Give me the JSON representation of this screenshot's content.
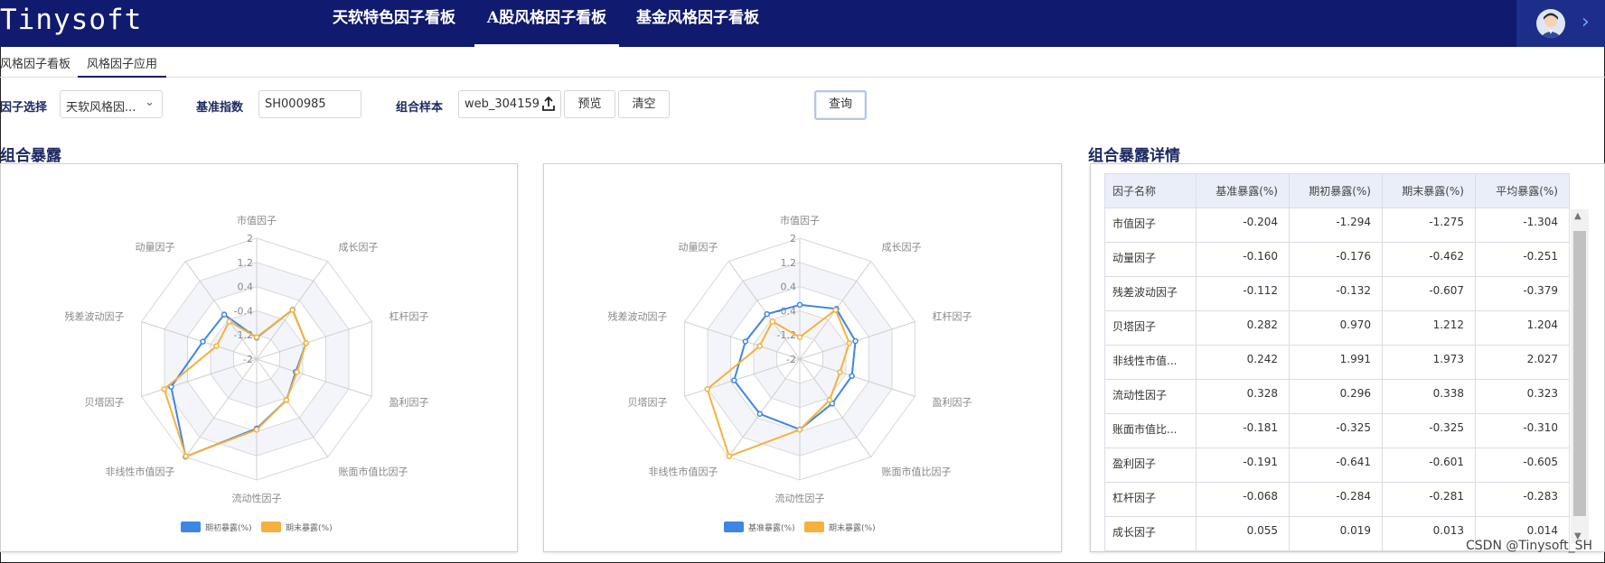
{
  "app": {
    "logo": "Tinysoft",
    "nav": [
      "天软特色因子看板",
      "A股风格因子看板",
      "基金风格因子看板"
    ],
    "nav_active_index": 1,
    "avatar_icon": "user-avatar-icon",
    "expand_icon": "chevron-right-icon"
  },
  "subtabs": [
    "风格因子看板",
    "风格因子应用"
  ],
  "subtab_active_index": 1,
  "filters": {
    "factor_label": "因子选择",
    "factor_value": "天软风格因...",
    "benchmark_label": "基准指数",
    "benchmark_value": "SH000985",
    "portfolio_label": "组合样本",
    "portfolio_value": "web_304159",
    "upload_icon": "upload-icon",
    "preview_button": "预览",
    "clear_button": "清空",
    "query_button": "查询"
  },
  "sections": {
    "exposure_title": "组合暴露",
    "detail_title": "组合暴露详情"
  },
  "colors": {
    "header_bg": "#101a6e",
    "blue_series": "#3e86e6",
    "orange_series": "#f5b13d"
  },
  "chart_data": [
    {
      "type": "radar",
      "indicators": [
        "市值因子",
        "成长因子",
        "杠杆因子",
        "盈利因子",
        "账面市值比因子",
        "流动性因子",
        "非线性市值因子",
        "贝塔因子",
        "残差波动因子",
        "动量因子"
      ],
      "ticks": [
        "2",
        "1.2",
        "0.4",
        "-0.4",
        "-1.2",
        "-2"
      ],
      "range": [
        -2,
        2
      ],
      "legend_position": "bottom",
      "series": [
        {
          "name": "期初暴露(%)",
          "color": "#3e86e6",
          "values": [
            -1.294,
            0.019,
            -0.284,
            -0.641,
            -0.325,
            0.296,
            1.991,
            0.97,
            -0.132,
            -0.176
          ]
        },
        {
          "name": "期末暴露(%)",
          "color": "#f5b13d",
          "values": [
            -1.275,
            0.013,
            -0.281,
            -0.601,
            -0.325,
            0.338,
            1.973,
            1.212,
            -0.607,
            -0.462
          ]
        }
      ]
    },
    {
      "type": "radar",
      "indicators": [
        "市值因子",
        "成长因子",
        "杠杆因子",
        "盈利因子",
        "账面市值比因子",
        "流动性因子",
        "非线性市值因子",
        "贝塔因子",
        "残差波动因子",
        "动量因子"
      ],
      "ticks": [
        "2",
        "1.2",
        "0.4",
        "-0.4",
        "-1.2",
        "-2"
      ],
      "range": [
        -2,
        2
      ],
      "legend_position": "bottom",
      "series": [
        {
          "name": "基准暴露(%)",
          "color": "#3e86e6",
          "values": [
            -0.204,
            0.055,
            -0.068,
            -0.191,
            -0.181,
            0.328,
            0.242,
            0.282,
            -0.112,
            -0.16
          ]
        },
        {
          "name": "期末暴露(%)",
          "color": "#f5b13d",
          "values": [
            -1.275,
            0.013,
            -0.281,
            -0.601,
            -0.325,
            0.338,
            1.973,
            1.212,
            -0.607,
            -0.462
          ]
        }
      ]
    }
  ],
  "table": {
    "headers": [
      "因子名称",
      "基准暴露(%)",
      "期初暴露(%)",
      "期末暴露(%)",
      "平均暴露(%)"
    ],
    "rows": [
      [
        "市值因子",
        "-0.204",
        "-1.294",
        "-1.275",
        "-1.304"
      ],
      [
        "动量因子",
        "-0.160",
        "-0.176",
        "-0.462",
        "-0.251"
      ],
      [
        "残差波动因子",
        "-0.112",
        "-0.132",
        "-0.607",
        "-0.379"
      ],
      [
        "贝塔因子",
        "0.282",
        "0.970",
        "1.212",
        "1.204"
      ],
      [
        "非线性市值...",
        "0.242",
        "1.991",
        "1.973",
        "2.027"
      ],
      [
        "流动性因子",
        "0.328",
        "0.296",
        "0.338",
        "0.323"
      ],
      [
        "账面市值比...",
        "-0.181",
        "-0.325",
        "-0.325",
        "-0.310"
      ],
      [
        "盈利因子",
        "-0.191",
        "-0.641",
        "-0.601",
        "-0.605"
      ],
      [
        "杠杆因子",
        "-0.068",
        "-0.284",
        "-0.281",
        "-0.283"
      ],
      [
        "成长因子",
        "0.055",
        "0.019",
        "0.013",
        "0.014"
      ]
    ]
  },
  "watermark": "CSDN @Tinysoft_SH"
}
